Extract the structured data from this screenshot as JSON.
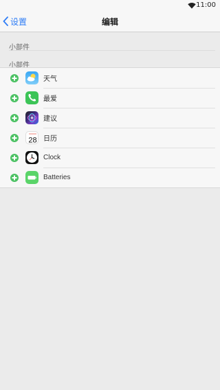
{
  "status_bar": {
    "time": "11:00",
    "wifi_icon": "wifi-icon"
  },
  "nav": {
    "back_label": "设置",
    "title": "编辑",
    "accent_color": "#2f7df6"
  },
  "sections": {
    "first_header": "小部件",
    "second_header": "小部件"
  },
  "widgets": [
    {
      "label": "天气",
      "icon": "weather-icon"
    },
    {
      "label": "最爱",
      "icon": "phone-icon"
    },
    {
      "label": "建议",
      "icon": "siri-icon"
    },
    {
      "label": "日历",
      "icon": "calendar-icon",
      "calendar_day": "28"
    },
    {
      "label": "Clock",
      "icon": "clock-icon"
    },
    {
      "label": "Batteries",
      "icon": "battery-icon"
    }
  ],
  "add_button_color": "#4bc163"
}
